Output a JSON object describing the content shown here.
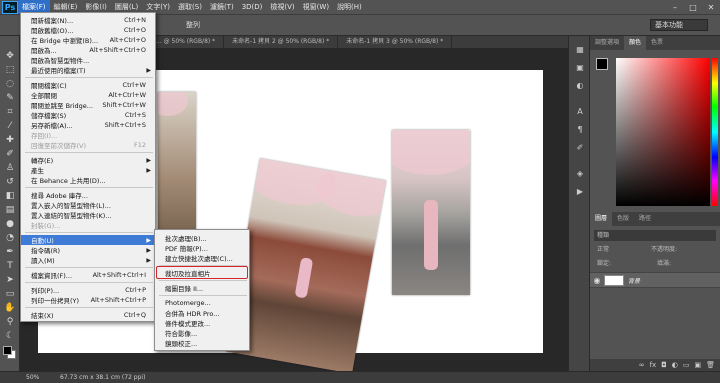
{
  "app": {
    "logo": "Ps"
  },
  "menubar": {
    "items": [
      "檔案(F)",
      "編輯(E)",
      "影像(I)",
      "圖層(L)",
      "文字(Y)",
      "選取(S)",
      "濾鏡(T)",
      "3D(D)",
      "檢視(V)",
      "視窗(W)",
      "說明(H)"
    ],
    "window_controls": [
      "–",
      "□",
      "✕"
    ]
  },
  "optionbar": {
    "mode_label": "整列",
    "workspace": "基本功能"
  },
  "tabs": [
    "... @ 50% (RGB/8) *",
    "未命名-1 拷貝 2 @ 50% (RGB/8) *",
    "未命名-1 拷貝 3 @ 50% (RGB/8) *"
  ],
  "file_menu": {
    "items": [
      {
        "label": "開新檔案(N)...",
        "shortcut": "Ctrl+N"
      },
      {
        "label": "開啟舊檔(O)...",
        "shortcut": "Ctrl+O"
      },
      {
        "label": "在 Bridge 中瀏覽(B)...",
        "shortcut": "Alt+Ctrl+O"
      },
      {
        "label": "開啟為...",
        "shortcut": "Alt+Shift+Ctrl+O"
      },
      {
        "label": "開啟為智慧型物件..."
      },
      {
        "label": "最近使用的檔案(T)",
        "submenu": true
      },
      {
        "label": "關閉檔案(C)",
        "shortcut": "Ctrl+W"
      },
      {
        "label": "全部關閉",
        "shortcut": "Alt+Ctrl+W"
      },
      {
        "label": "關閉並跳至 Bridge...",
        "shortcut": "Shift+Ctrl+W"
      },
      {
        "label": "儲存檔案(S)",
        "shortcut": "Ctrl+S"
      },
      {
        "label": "另存新檔(A)...",
        "shortcut": "Shift+Ctrl+S"
      },
      {
        "label": "存回(I)...",
        "disabled": true
      },
      {
        "label": "回復至前次儲存(V)",
        "shortcut": "F12",
        "disabled": true
      },
      {
        "label": "轉存(E)",
        "submenu": true
      },
      {
        "label": "產生",
        "submenu": true
      },
      {
        "label": "在 Behance 上共用(D)..."
      },
      {
        "label": "搜尋 Adobe 庫存..."
      },
      {
        "label": "置入嵌入的智慧型物件(L)..."
      },
      {
        "label": "置入連結的智慧型物件(K)..."
      },
      {
        "label": "封裝(G)...",
        "disabled": true
      },
      {
        "label": "自動(U)",
        "submenu": true,
        "highlighted": true
      },
      {
        "label": "指令碼(R)",
        "submenu": true
      },
      {
        "label": "讀入(M)",
        "submenu": true
      },
      {
        "label": "檔案資訊(F)...",
        "shortcut": "Alt+Shift+Ctrl+I"
      },
      {
        "label": "列印(P)...",
        "shortcut": "Ctrl+P"
      },
      {
        "label": "列印一份拷貝(Y)",
        "shortcut": "Alt+Shift+Ctrl+P"
      },
      {
        "label": "結束(X)",
        "shortcut": "Ctrl+Q"
      }
    ]
  },
  "automate_submenu": {
    "items": [
      "批次處理(B)...",
      "PDF 簡報(P)...",
      "建立快捷批次處理(C)...",
      "裁切及拉直相片",
      "縮圖目錄 II...",
      "Photomerge...",
      "合併為 HDR Pro...",
      "條件模式更改...",
      "符合影像...",
      "鏡頭校正..."
    ],
    "highlighted": "裁切及拉直相片"
  },
  "right_panels": {
    "top_tabs": [
      "調整選項",
      "顏色",
      "色票"
    ],
    "layer_tabs": [
      "圖層",
      "色版",
      "路徑"
    ],
    "filter_label": "種類",
    "blend_mode": "正常",
    "opacity_label": "不透明度:",
    "lock_label": "鎖定:",
    "fill_label": "填滿:",
    "layer_name": "背景",
    "fg_color": "#000000",
    "accent": "#3d7bd6"
  },
  "status": {
    "zoom": "50%",
    "doc_info": "67.73 cm x 38.1 cm (72 ppi)"
  }
}
